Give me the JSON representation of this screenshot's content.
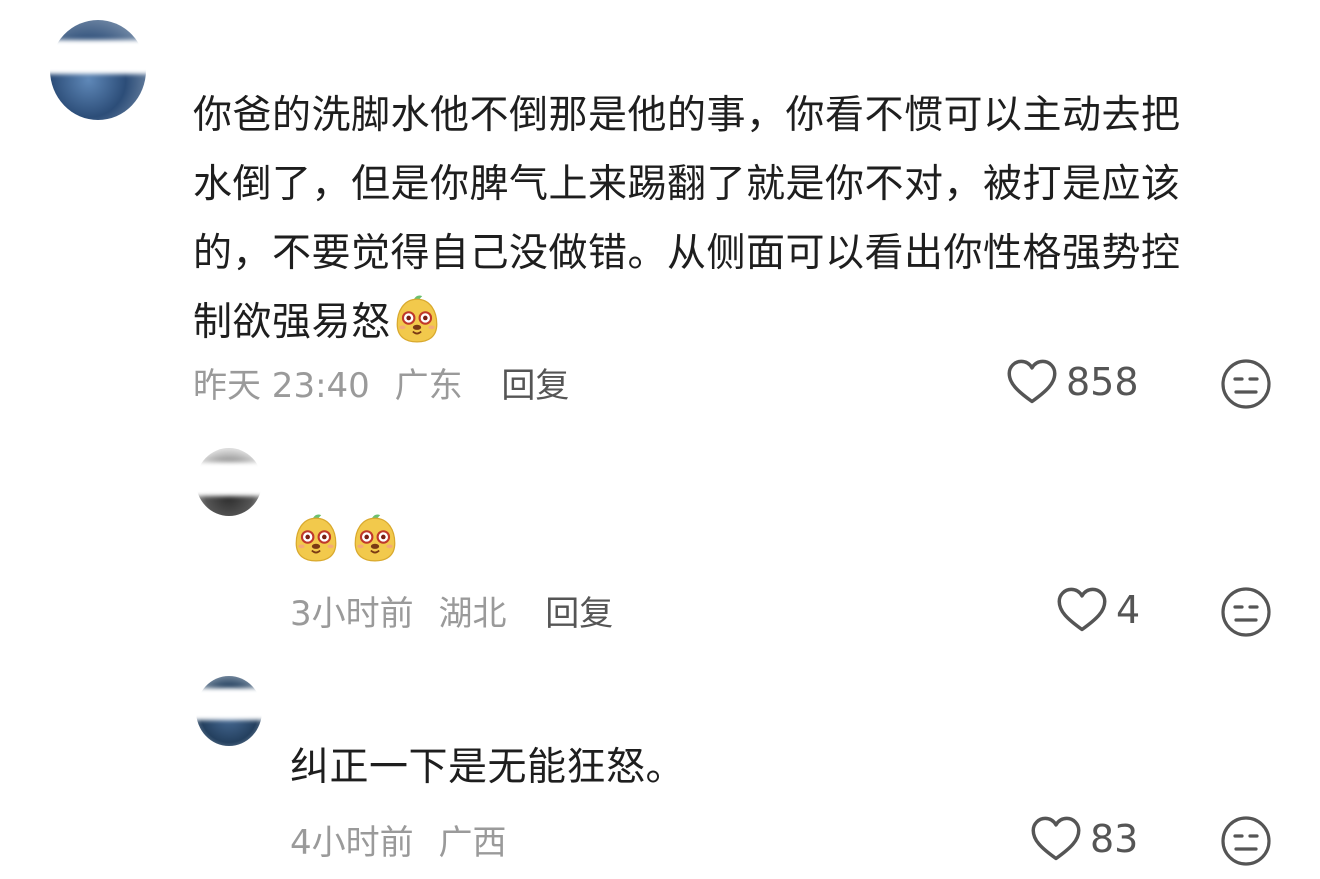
{
  "comments": [
    {
      "text_lines": [
        "你爸的洗脚水他不倒那是他的事，你看不惯可以主动去把",
        "水倒了，但是你脾气上来踢翻了就是你不对，被打是应该",
        "的，不要觉得自己没做错。从侧面可以看出你性格强势控",
        "制欲强易怒"
      ],
      "emoji_after_last_line": "sticker-face-icon",
      "time": "昨天 23:40",
      "location": "广东",
      "reply_label": "回复",
      "likes": "858"
    },
    {
      "emojis": [
        "sticker-face-icon",
        "sticker-face-icon"
      ],
      "time": "3小时前",
      "location": "湖北",
      "reply_label": "回复",
      "likes": "4"
    },
    {
      "text": "纠正一下是无能狂怒。",
      "time": "4小时前",
      "location": "广西",
      "likes": "83"
    }
  ],
  "colors": {
    "text": "#1e1e1e",
    "meta": "#9a9a9a",
    "reply": "#555555",
    "icon": "#555555",
    "sticker": "#f2c94c"
  }
}
